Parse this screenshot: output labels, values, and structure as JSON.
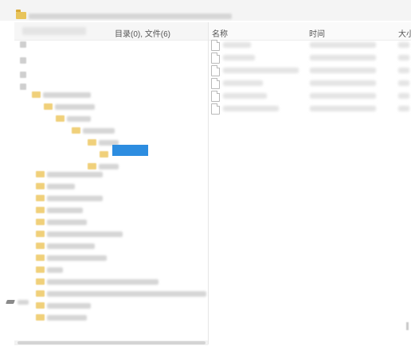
{
  "window": {
    "icon": "folder-icon"
  },
  "left_pane": {
    "header_stats": "目录(0), 文件(6)"
  },
  "right_pane": {
    "columns": {
      "name": "名称",
      "time": "时间",
      "size": "大小"
    }
  },
  "colors": {
    "selected": "#2d8de0",
    "folder": "#f0d07a"
  }
}
